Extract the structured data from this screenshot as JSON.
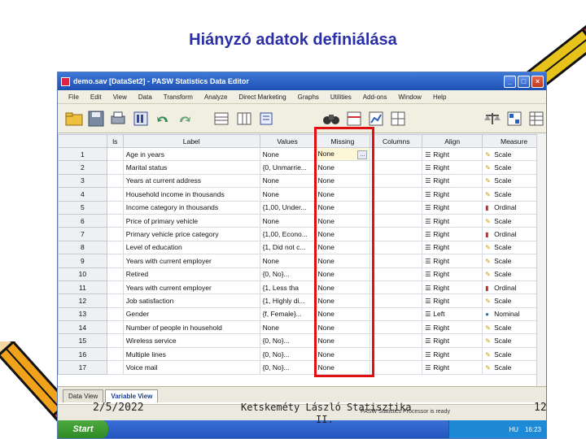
{
  "slide": {
    "title": "Hiányzó adatok definiálása",
    "footer_date": "2/5/2022",
    "footer_center_line1": "Ketskeméty László Statisztika",
    "footer_center_line2": "II.",
    "footer_page": "12"
  },
  "window": {
    "title": "demo.sav [DataSet2] - PASW Statistics Data Editor",
    "minimize": "_",
    "maximize": "□",
    "close": "×"
  },
  "menu": [
    "File",
    "Edit",
    "View",
    "Data",
    "Transform",
    "Analyze",
    "Direct Marketing",
    "Graphs",
    "Utilities",
    "Add-ons",
    "Window",
    "Help"
  ],
  "grid": {
    "columns": [
      "ls",
      "Label",
      "Values",
      "Missing",
      "Columns",
      "Align",
      "Measure"
    ],
    "rows": [
      {
        "n": "1",
        "label": "Age in years",
        "values": "None",
        "missing": "None",
        "align": "Right",
        "measure": "Scale"
      },
      {
        "n": "2",
        "label": "Marital status",
        "values": "{0, Unmarrie...",
        "missing": "None",
        "align": "Right",
        "measure": "Scale"
      },
      {
        "n": "3",
        "label": "Years at current address",
        "values": "None",
        "missing": "None",
        "align": "Right",
        "measure": "Scale"
      },
      {
        "n": "4",
        "label": "Household income in thousands",
        "values": "None",
        "missing": "None",
        "align": "Right",
        "measure": "Scale"
      },
      {
        "n": "5",
        "label": "Income category in thousands",
        "values": "{1,00, Under...",
        "missing": "None",
        "align": "Right",
        "measure": "Ordinal"
      },
      {
        "n": "6",
        "label": "Price of primary vehicle",
        "values": "None",
        "missing": "None",
        "align": "Right",
        "measure": "Scale"
      },
      {
        "n": "7",
        "label": "Primary vehicle price category",
        "values": "{1,00, Econo...",
        "missing": "None",
        "align": "Right",
        "measure": "Ordinal"
      },
      {
        "n": "8",
        "label": "Level of education",
        "values": "{1, Did not c...",
        "missing": "None",
        "align": "Right",
        "measure": "Scale"
      },
      {
        "n": "9",
        "label": "Years with current employer",
        "values": "None",
        "missing": "None",
        "align": "Right",
        "measure": "Scale"
      },
      {
        "n": "10",
        "label": "Retired",
        "values": "{0, No}...",
        "missing": "None",
        "align": "Right",
        "measure": "Scale"
      },
      {
        "n": "11",
        "label": "Years with current employer",
        "values": "{1, Less tha",
        "missing": "None",
        "align": "Right",
        "measure": "Ordinal"
      },
      {
        "n": "12",
        "label": "Job satisfaction",
        "values": "{1, Highly di...",
        "missing": "None",
        "align": "Right",
        "measure": "Scale"
      },
      {
        "n": "13",
        "label": "Gender",
        "values": "{f, Female}...",
        "missing": "None",
        "align": "Left",
        "measure": "Nominal"
      },
      {
        "n": "14",
        "label": "Number of people in household",
        "values": "None",
        "missing": "None",
        "align": "Right",
        "measure": "Scale"
      },
      {
        "n": "15",
        "label": "Wireless service",
        "values": "{0, No}...",
        "missing": "None",
        "align": "Right",
        "measure": "Scale"
      },
      {
        "n": "16",
        "label": "Multiple lines",
        "values": "{0, No}...",
        "missing": "None",
        "align": "Right",
        "measure": "Scale"
      },
      {
        "n": "17",
        "label": "Voice mail",
        "values": "{0, No}...",
        "missing": "None",
        "align": "Right",
        "measure": "Scale"
      }
    ],
    "ellipsis": "..."
  },
  "tabs": {
    "data_view": "Data View",
    "variable_view": "Variable View"
  },
  "status": {
    "text": "PASW Statistics Processor is ready"
  },
  "taskbar": {
    "start": "Start",
    "clock": "16:23",
    "lang": "HU"
  },
  "colors": {
    "title": "#2a2fa8",
    "highlight": "#e01010",
    "titlebar": "#2a5fc4"
  }
}
